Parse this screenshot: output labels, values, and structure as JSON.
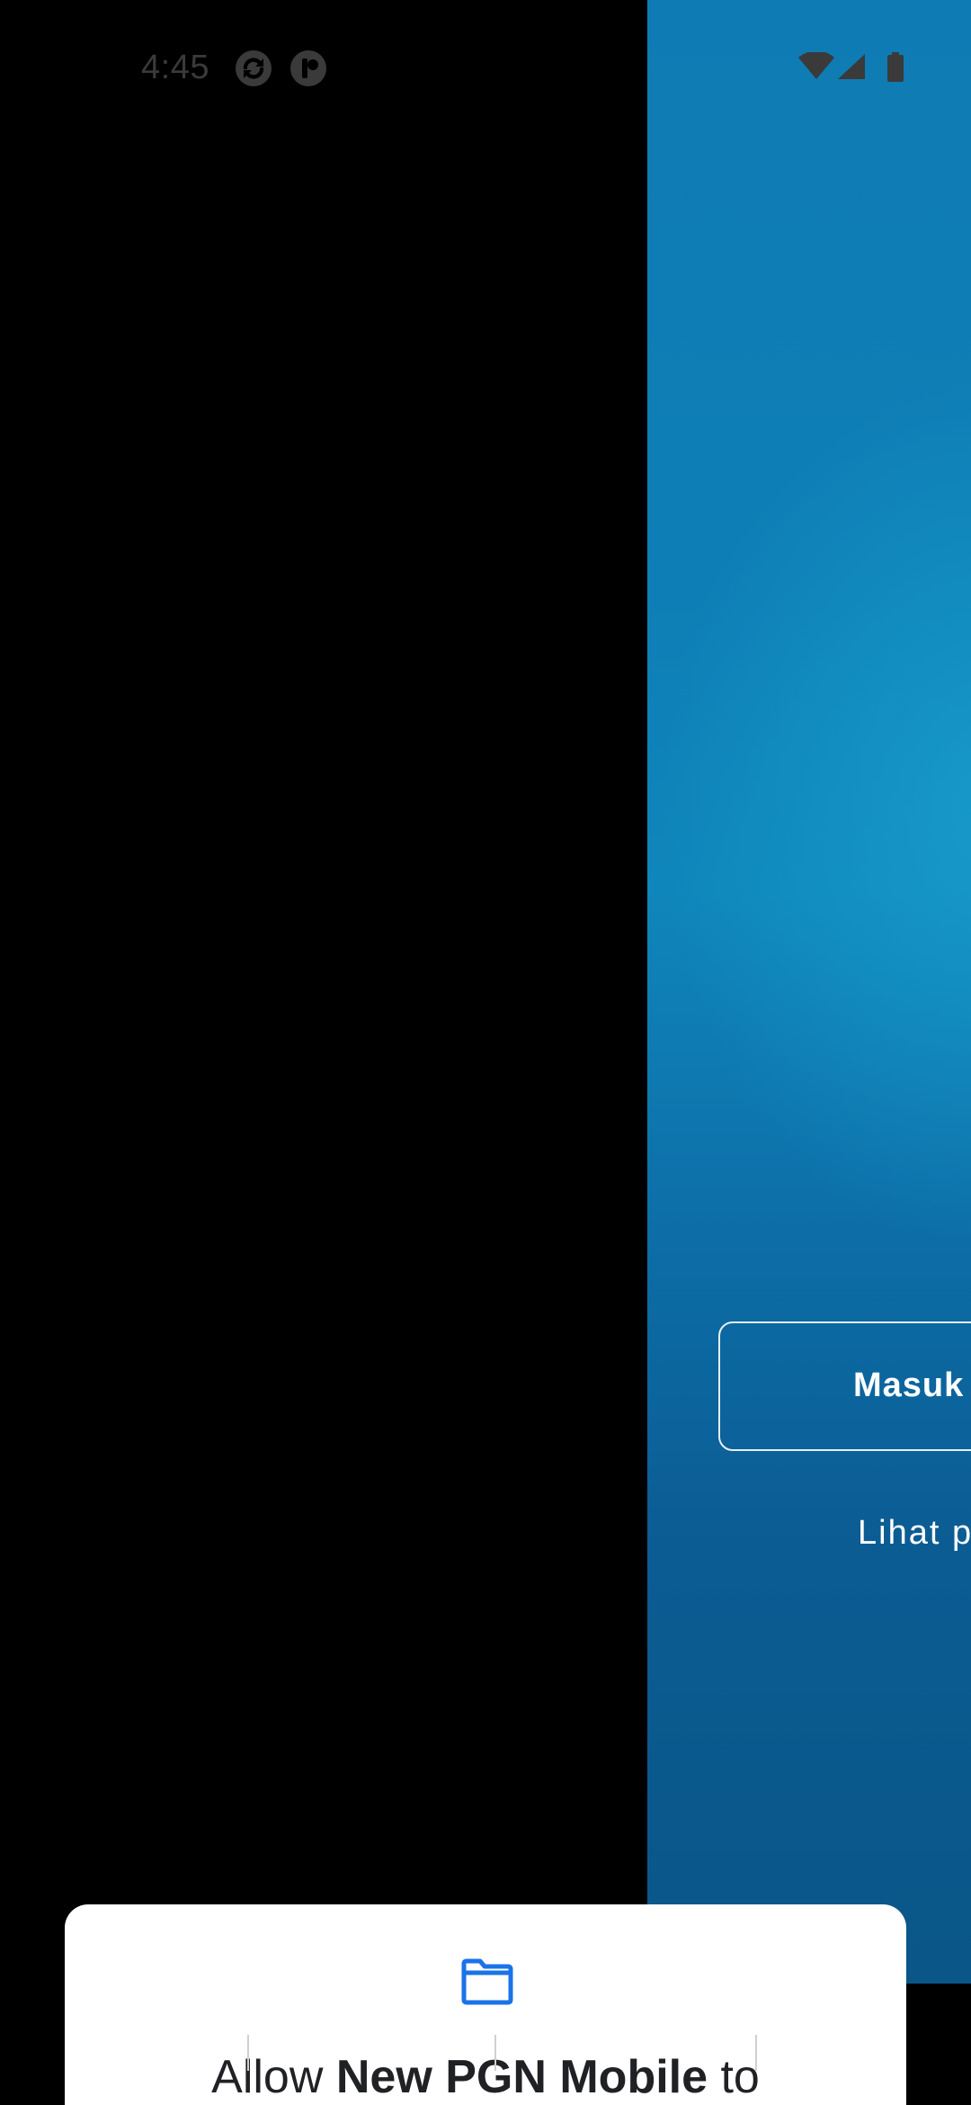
{
  "status_bar": {
    "time": "4:45",
    "left_icons": [
      "sync-app-icon",
      "notification-app-icon"
    ],
    "right_icons": [
      "wifi-icon",
      "cellular-signal-icon",
      "battery-icon"
    ]
  },
  "app": {
    "login_button_label": "Masuk",
    "guest_link_label": "Lihat p",
    "colors": {
      "panel_top": "#0f7bb4",
      "panel_bottom": "#0a5688",
      "background_left": "#000000"
    }
  },
  "permission_dialog": {
    "icon": "folder-icon",
    "title_prefix": "Allow ",
    "title_app_name": "New PGN Mobile",
    "title_suffix": " to",
    "accent_color": "#1a73e8"
  }
}
